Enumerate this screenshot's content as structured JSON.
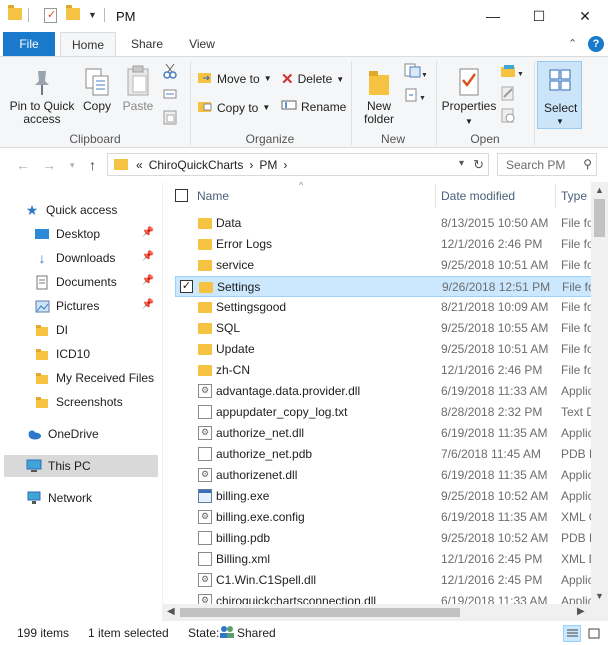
{
  "window": {
    "title": "PM",
    "close_glyph": "✕",
    "maximize_glyph": "☐",
    "minimize_glyph": "—"
  },
  "ribbon_tabs": {
    "file": "File",
    "home": "Home",
    "share": "Share",
    "view": "View"
  },
  "ribbon": {
    "clipboard": {
      "label": "Clipboard",
      "pin": "Pin to Quick access",
      "pin_line1": "Pin to Quick",
      "pin_line2": "access",
      "copy": "Copy",
      "paste": "Paste"
    },
    "organize": {
      "label": "Organize",
      "move_to": "Move to",
      "copy_to": "Copy to",
      "delete": "Delete",
      "rename": "Rename"
    },
    "new": {
      "label": "New",
      "new_folder_line1": "New",
      "new_folder_line2": "folder"
    },
    "open": {
      "label": "Open",
      "properties": "Properties"
    },
    "select": {
      "label": "Select"
    }
  },
  "address": {
    "crumbs": [
      "«",
      "ChiroQuickCharts",
      "›",
      "PM",
      "›"
    ],
    "search_placeholder": "Search PM"
  },
  "nav_pane": {
    "items": [
      {
        "label": "Quick access",
        "icon": "star-icon"
      },
      {
        "label": "Desktop",
        "icon": "desktop-icon",
        "pinned": true
      },
      {
        "label": "Downloads",
        "icon": "download-icon",
        "pinned": true
      },
      {
        "label": "Documents",
        "icon": "documents-icon",
        "pinned": true
      },
      {
        "label": "Pictures",
        "icon": "pictures-icon",
        "pinned": true
      },
      {
        "label": "DI",
        "icon": "folder-icon"
      },
      {
        "label": "ICD10",
        "icon": "folder-icon"
      },
      {
        "label": "My Received Files",
        "icon": "folder-icon"
      },
      {
        "label": "Screenshots",
        "icon": "folder-icon"
      },
      {
        "label": "OneDrive",
        "icon": "cloud-icon"
      },
      {
        "label": "This PC",
        "icon": "computer-icon",
        "selected": true
      },
      {
        "label": "Network",
        "icon": "network-icon"
      }
    ]
  },
  "columns": {
    "name": "Name",
    "date": "Date modified",
    "type": "Type"
  },
  "files": [
    {
      "name": "Data",
      "date": "8/13/2015 10:50 AM",
      "type": "File fo",
      "kind": "folder"
    },
    {
      "name": "Error Logs",
      "date": "12/1/2016 2:46 PM",
      "type": "File fo",
      "kind": "folder"
    },
    {
      "name": "service",
      "date": "9/25/2018 10:51 AM",
      "type": "File fo",
      "kind": "folder"
    },
    {
      "name": "Settings",
      "date": "9/26/2018 12:51 PM",
      "type": "File fo",
      "kind": "folder",
      "selected": true
    },
    {
      "name": "Settingsgood",
      "date": "8/21/2018 10:09 AM",
      "type": "File fo",
      "kind": "folder"
    },
    {
      "name": "SQL",
      "date": "9/25/2018 10:55 AM",
      "type": "File fo",
      "kind": "folder"
    },
    {
      "name": "Update",
      "date": "9/25/2018 10:51 AM",
      "type": "File fo",
      "kind": "folder"
    },
    {
      "name": "zh-CN",
      "date": "12/1/2016 2:46 PM",
      "type": "File fo",
      "kind": "folder"
    },
    {
      "name": "advantage.data.provider.dll",
      "date": "6/19/2018 11:33 AM",
      "type": "Applic",
      "kind": "dll"
    },
    {
      "name": "appupdater_copy_log.txt",
      "date": "8/28/2018 2:32 PM",
      "type": "Text D",
      "kind": "doc"
    },
    {
      "name": "authorize_net.dll",
      "date": "6/19/2018 11:35 AM",
      "type": "Applic",
      "kind": "dll"
    },
    {
      "name": "authorize_net.pdb",
      "date": "7/6/2018 11:45 AM",
      "type": "PDB F",
      "kind": "doc"
    },
    {
      "name": "authorizenet.dll",
      "date": "6/19/2018 11:35 AM",
      "type": "Applic",
      "kind": "dll"
    },
    {
      "name": "billing.exe",
      "date": "9/25/2018 10:52 AM",
      "type": "Applic",
      "kind": "exe"
    },
    {
      "name": "billing.exe.config",
      "date": "6/19/2018 11:35 AM",
      "type": "XML C",
      "kind": "dll"
    },
    {
      "name": "billing.pdb",
      "date": "9/25/2018 10:52 AM",
      "type": "PDB F",
      "kind": "doc"
    },
    {
      "name": "Billing.xml",
      "date": "12/1/2016 2:45 PM",
      "type": "XML D",
      "kind": "doc"
    },
    {
      "name": "C1.Win.C1Spell.dll",
      "date": "12/1/2016 2:45 PM",
      "type": "Applic",
      "kind": "dll"
    },
    {
      "name": "chiroquickchartsconnection.dll",
      "date": "6/19/2018 11:33 AM",
      "type": "Applic",
      "kind": "dll"
    }
  ],
  "status": {
    "count": "199 items",
    "selected": "1 item selected",
    "state_label": "State:",
    "state_value": "Shared"
  }
}
